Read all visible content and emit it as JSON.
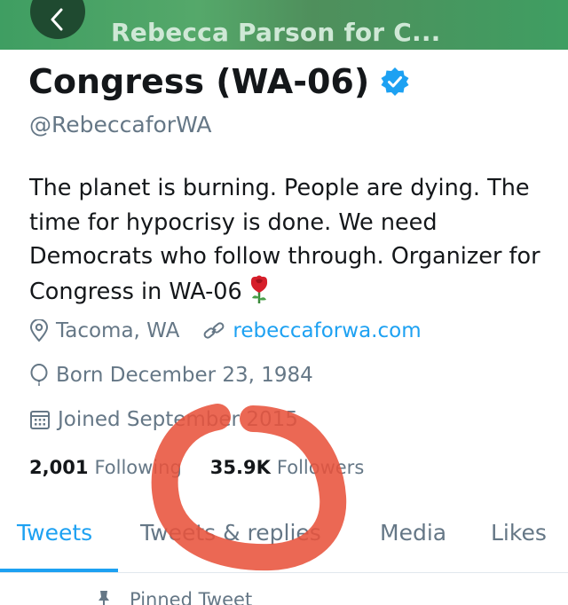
{
  "header": {
    "title": "Rebecca Parson for C...",
    "back_icon": "chevron-left-icon",
    "background_color": "#3f9e62"
  },
  "profile": {
    "display_name": "Congress (WA-06)",
    "verified_icon": "verified-badge-icon",
    "handle": "@RebeccaforWA",
    "bio": "The planet is burning. People are dying. The time for hypocrisy is done. We need Democrats who follow through. Organizer for Congress in WA-06",
    "bio_emoji": "rose-icon",
    "location": "Tacoma, WA",
    "website": "rebeccaforwa.com",
    "birthday": "Born December 23, 1984",
    "joined": "Joined September 2015"
  },
  "stats": {
    "following_count": "2,001",
    "following_label": "Following",
    "followers_count": "35.9K",
    "followers_label": "Followers"
  },
  "tabs": [
    {
      "label": "Tweets",
      "active": true
    },
    {
      "label": "Tweets & replies",
      "active": false
    },
    {
      "label": "Media",
      "active": false
    },
    {
      "label": "Likes",
      "active": false
    }
  ],
  "pinned": {
    "label": "Pinned Tweet",
    "icon": "pin-icon"
  },
  "colors": {
    "accent": "#1da1f2",
    "secondary_text": "#657786",
    "annotation": "#e8533c"
  }
}
